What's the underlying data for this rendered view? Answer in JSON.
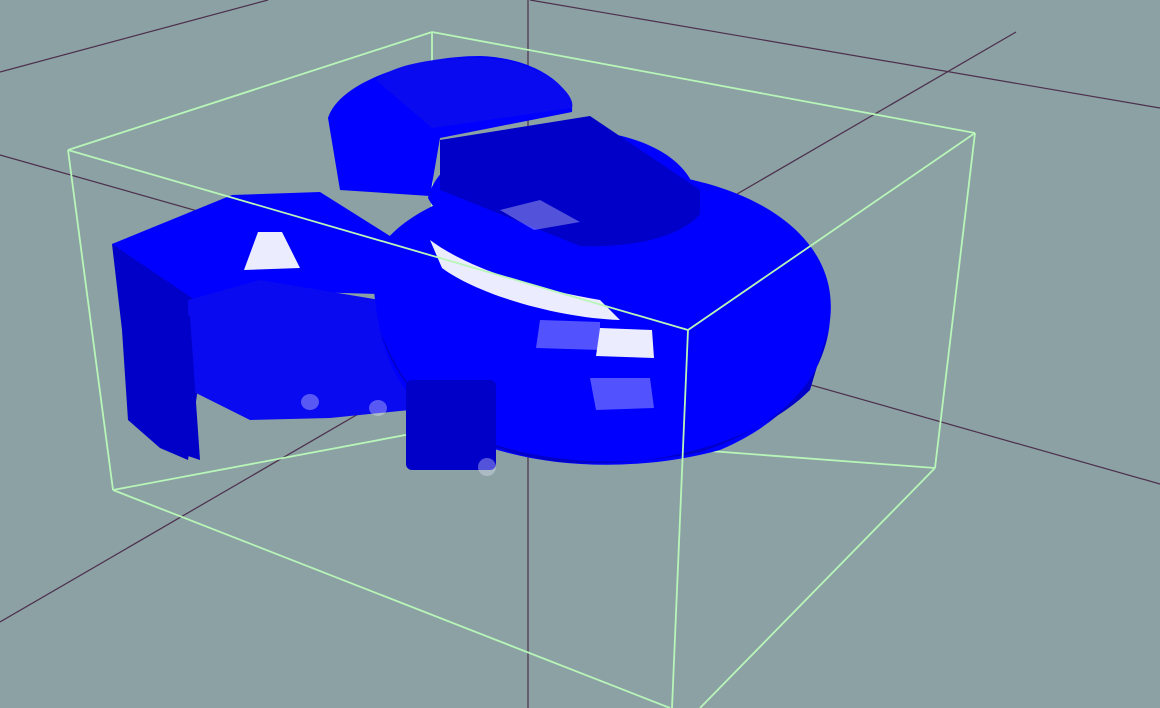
{
  "viewport": {
    "background": "#8ba1a3",
    "axis_color": "#4d2f4d",
    "bbox_color": "#b8f5b8",
    "model_color": "#0000ff",
    "model_shade_dark": "#0000c8",
    "model_shade_mid": "#0a0af0",
    "highlight_color": "#ececff"
  }
}
